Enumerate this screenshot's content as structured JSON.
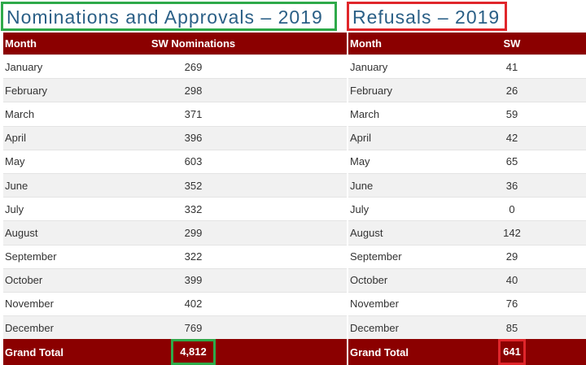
{
  "left": {
    "title": "Nominations and Approvals – 2019",
    "headers": {
      "month": "Month",
      "value": "SW Nominations"
    },
    "rows": [
      {
        "month": "January",
        "value": "269"
      },
      {
        "month": "February",
        "value": "298"
      },
      {
        "month": "March",
        "value": "371"
      },
      {
        "month": "April",
        "value": "396"
      },
      {
        "month": "May",
        "value": "603"
      },
      {
        "month": "June",
        "value": "352"
      },
      {
        "month": "July",
        "value": "332"
      },
      {
        "month": "August",
        "value": "299"
      },
      {
        "month": "September",
        "value": "322"
      },
      {
        "month": "October",
        "value": "399"
      },
      {
        "month": "November",
        "value": "402"
      },
      {
        "month": "December",
        "value": "769"
      }
    ],
    "total": {
      "label": "Grand Total",
      "value": "4,812"
    }
  },
  "right": {
    "title": "Refusals – 2019",
    "headers": {
      "month": "Month",
      "value": "SW"
    },
    "rows": [
      {
        "month": "January",
        "value": "41"
      },
      {
        "month": "February",
        "value": "26"
      },
      {
        "month": "March",
        "value": "59"
      },
      {
        "month": "April",
        "value": "42"
      },
      {
        "month": "May",
        "value": "65"
      },
      {
        "month": "June",
        "value": "36"
      },
      {
        "month": "July",
        "value": "0"
      },
      {
        "month": "August",
        "value": "142"
      },
      {
        "month": "September",
        "value": "29"
      },
      {
        "month": "October",
        "value": "40"
      },
      {
        "month": "November",
        "value": "76"
      },
      {
        "month": "December",
        "value": "85"
      }
    ],
    "total": {
      "label": "Grand Total",
      "value": "641"
    }
  },
  "colors": {
    "header_bg": "#8b0000",
    "title_text": "#2a5f86",
    "highlight_green": "#2eaa4a",
    "highlight_red": "#e0262b"
  }
}
